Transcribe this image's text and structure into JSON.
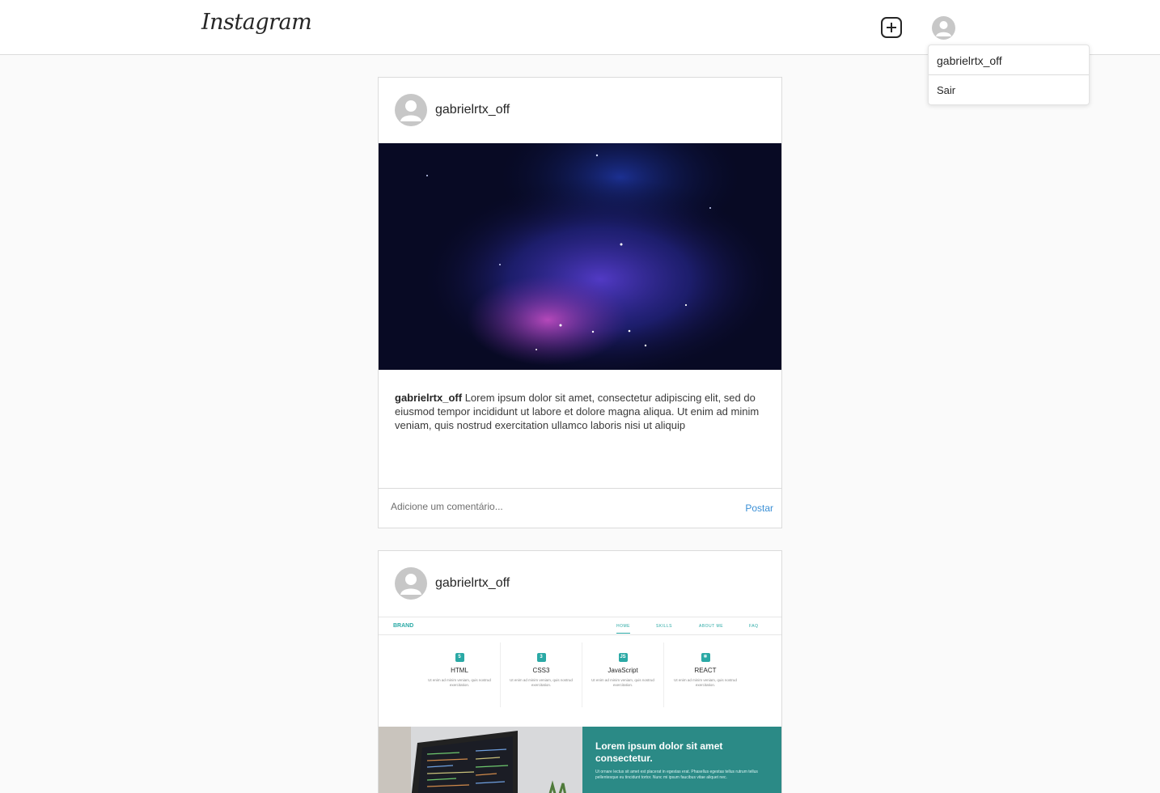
{
  "app": {
    "logo": "Instagram"
  },
  "header": {
    "new_post_icon": "plus-square-icon",
    "profile_icon": "user-avatar-icon"
  },
  "menu": {
    "username": "gabrielrtx_off",
    "logout": "Sair"
  },
  "posts": [
    {
      "username": "gabrielrtx_off",
      "image": "purple-blue-galaxy-nebula",
      "caption_user": "gabrielrtx_off",
      "caption_text": "Lorem ipsum dolor sit amet, consectetur adipiscing elit, sed do eiusmod tempor incididunt ut labore et dolore magna aliqua. Ut enim ad minim veniam, quis nostrud exercitation ullamco laboris nisi ut aliquip",
      "comment_placeholder": "Adicione um comentário...",
      "post_button": "Postar"
    },
    {
      "username": "gabrielrtx_off",
      "image": "portfolio-website-screenshot",
      "website": {
        "brand": "BRAND",
        "nav": [
          "HOME",
          "SKILLS",
          "ABOUT ME",
          "FAQ"
        ],
        "skills": [
          {
            "name": "HTML",
            "icon": "5",
            "desc": "Ut enim ad minim veniam, quis nostrud exercitation."
          },
          {
            "name": "CSS3",
            "icon": "3",
            "desc": "Ut enim ad minim veniam, quis nostrud exercitation."
          },
          {
            "name": "JavaScript",
            "icon": "JS",
            "desc": "Ut enim ad minim veniam, quis nostrud exercitation."
          },
          {
            "name": "REACT",
            "icon": "⚛",
            "desc": "Ut enim ad minim veniam, quis nostrud exercitation."
          }
        ],
        "hero_title": "Lorem ipsum dolor sit amet consectetur.",
        "hero_text": "Ut ornare lectus sit amet est placerat in egestas erat. Phasellus egestas tellus rutrum tellus pellentesque eu tincidunt tortor. Nunc mi ipsum faucibus vitae aliquet nec."
      }
    }
  ]
}
